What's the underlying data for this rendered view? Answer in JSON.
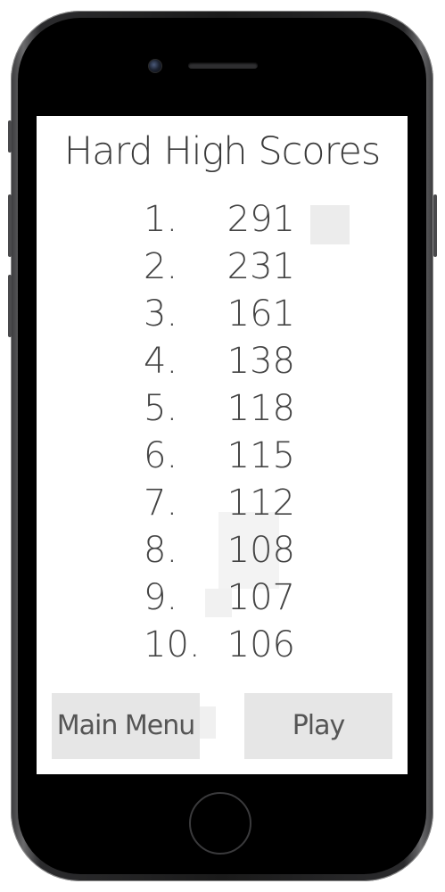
{
  "screen": {
    "title": "Hard High Scores",
    "scores": [
      {
        "rank": "1.",
        "score": "291"
      },
      {
        "rank": "2.",
        "score": "231"
      },
      {
        "rank": "3.",
        "score": "161"
      },
      {
        "rank": "4.",
        "score": "138"
      },
      {
        "rank": "5.",
        "score": "118"
      },
      {
        "rank": "6.",
        "score": "115"
      },
      {
        "rank": "7.",
        "score": "112"
      },
      {
        "rank": "8.",
        "score": "108"
      },
      {
        "rank": "9.",
        "score": "107"
      },
      {
        "rank": "10.",
        "score": "106"
      }
    ],
    "buttons": {
      "main_menu": "Main Menu",
      "play": "Play"
    }
  },
  "device": {
    "frame_color": "#1a1a1a",
    "screen_color": "#ffffff",
    "button_color": "#e6e6e6",
    "text_color": "#444444"
  }
}
